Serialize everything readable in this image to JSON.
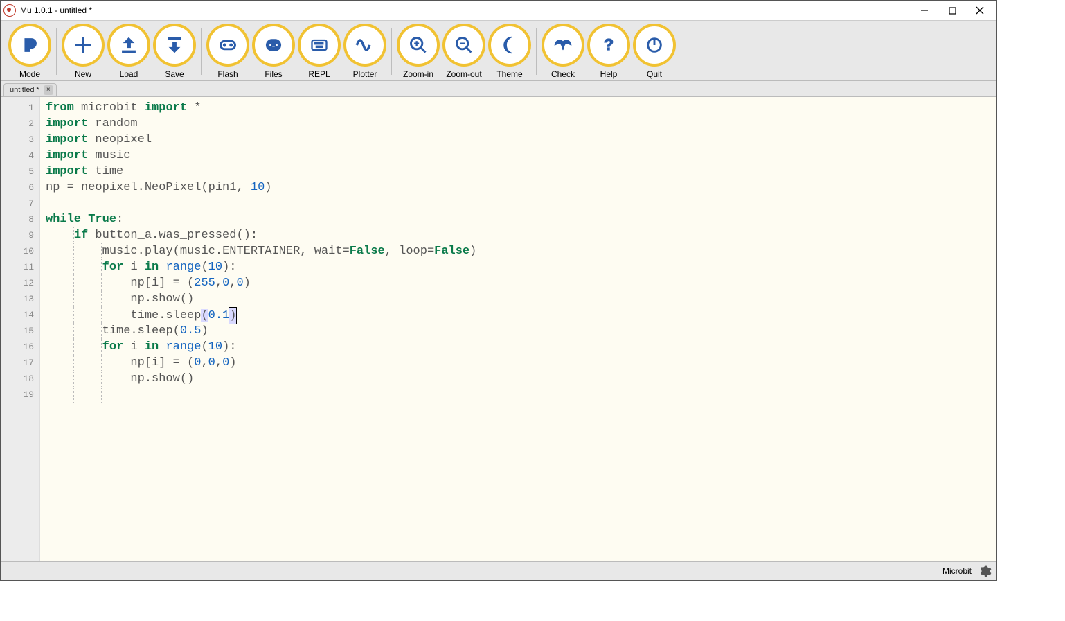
{
  "window": {
    "title": "Mu 1.0.1 - untitled *"
  },
  "toolbar": {
    "groups": [
      [
        "Mode"
      ],
      [
        "New",
        "Load",
        "Save"
      ],
      [
        "Flash",
        "Files",
        "REPL",
        "Plotter"
      ],
      [
        "Zoom-in",
        "Zoom-out",
        "Theme"
      ],
      [
        "Check",
        "Help",
        "Quit"
      ]
    ]
  },
  "tab": {
    "label": "untitled *"
  },
  "code": {
    "lines": [
      {
        "n": 1,
        "tokens": [
          [
            "kw",
            "from"
          ],
          [
            " ",
            " "
          ],
          [
            "name",
            "microbit"
          ],
          [
            " ",
            " "
          ],
          [
            "kw",
            "import"
          ],
          [
            " ",
            " "
          ],
          [
            "op",
            "*"
          ]
        ]
      },
      {
        "n": 2,
        "tokens": [
          [
            "kw",
            "import"
          ],
          [
            " ",
            " "
          ],
          [
            "name",
            "random"
          ]
        ]
      },
      {
        "n": 3,
        "tokens": [
          [
            "kw",
            "import"
          ],
          [
            " ",
            " "
          ],
          [
            "name",
            "neopixel"
          ]
        ]
      },
      {
        "n": 4,
        "tokens": [
          [
            "kw",
            "import"
          ],
          [
            " ",
            " "
          ],
          [
            "name",
            "music"
          ]
        ]
      },
      {
        "n": 5,
        "tokens": [
          [
            "kw",
            "import"
          ],
          [
            " ",
            " "
          ],
          [
            "name",
            "time"
          ]
        ]
      },
      {
        "n": 6,
        "tokens": [
          [
            "name",
            "np"
          ],
          [
            " ",
            " "
          ],
          [
            "op",
            "="
          ],
          [
            " ",
            " "
          ],
          [
            "name",
            "neopixel.NeoPixel"
          ],
          [
            "punct",
            "("
          ],
          [
            "name",
            "pin1"
          ],
          [
            "punct",
            ","
          ],
          [
            " ",
            " "
          ],
          [
            "num",
            "10"
          ],
          [
            "punct",
            ")"
          ]
        ]
      },
      {
        "n": 7,
        "tokens": []
      },
      {
        "n": 8,
        "tokens": [
          [
            "kw",
            "while"
          ],
          [
            " ",
            " "
          ],
          [
            "const",
            "True"
          ],
          [
            "punct",
            ":"
          ]
        ]
      },
      {
        "n": 9,
        "indent": 1,
        "tokens": [
          [
            "kw",
            "if"
          ],
          [
            " ",
            " "
          ],
          [
            "name",
            "button_a.was_pressed"
          ],
          [
            "punct",
            "()"
          ],
          [
            "punct",
            ":"
          ]
        ]
      },
      {
        "n": 10,
        "indent": 2,
        "tokens": [
          [
            "name",
            "music.play"
          ],
          [
            "punct",
            "("
          ],
          [
            "name",
            "music.ENTERTAINER"
          ],
          [
            "punct",
            ","
          ],
          [
            " ",
            " "
          ],
          [
            "name",
            "wait"
          ],
          [
            "op",
            "="
          ],
          [
            "const",
            "False"
          ],
          [
            "punct",
            ","
          ],
          [
            " ",
            " "
          ],
          [
            "name",
            "loop"
          ],
          [
            "op",
            "="
          ],
          [
            "const",
            "False"
          ],
          [
            "punct",
            ")"
          ]
        ]
      },
      {
        "n": 11,
        "indent": 2,
        "tokens": [
          [
            "kw",
            "for"
          ],
          [
            " ",
            " "
          ],
          [
            "name",
            "i"
          ],
          [
            " ",
            " "
          ],
          [
            "kw",
            "in"
          ],
          [
            " ",
            " "
          ],
          [
            "builtin",
            "range"
          ],
          [
            "punct",
            "("
          ],
          [
            "num",
            "10"
          ],
          [
            "punct",
            ")"
          ],
          [
            "punct",
            ":"
          ]
        ]
      },
      {
        "n": 12,
        "indent": 3,
        "tokens": [
          [
            "name",
            "np"
          ],
          [
            "punct",
            "["
          ],
          [
            "name",
            "i"
          ],
          [
            "punct",
            "]"
          ],
          [
            " ",
            " "
          ],
          [
            "op",
            "="
          ],
          [
            " ",
            " "
          ],
          [
            "punct",
            "("
          ],
          [
            "num",
            "255"
          ],
          [
            "punct",
            ","
          ],
          [
            "num",
            "0"
          ],
          [
            "punct",
            ","
          ],
          [
            "num",
            "0"
          ],
          [
            "punct",
            ")"
          ]
        ]
      },
      {
        "n": 13,
        "indent": 3,
        "tokens": [
          [
            "name",
            "np.show"
          ],
          [
            "punct",
            "()"
          ]
        ]
      },
      {
        "n": 14,
        "indent": 3,
        "highlight": true,
        "tokens": [
          [
            "name",
            "time.sleep"
          ],
          [
            "hl-paren",
            "("
          ],
          [
            "num",
            "0.1"
          ],
          [
            "hl-paren-cursor",
            ")"
          ]
        ]
      },
      {
        "n": 15,
        "indent": 2,
        "tokens": [
          [
            "name",
            "time.sleep"
          ],
          [
            "punct",
            "("
          ],
          [
            "num",
            "0.5"
          ],
          [
            "punct",
            ")"
          ]
        ]
      },
      {
        "n": 16,
        "indent": 2,
        "tokens": [
          [
            "kw",
            "for"
          ],
          [
            " ",
            " "
          ],
          [
            "name",
            "i"
          ],
          [
            " ",
            " "
          ],
          [
            "kw",
            "in"
          ],
          [
            " ",
            " "
          ],
          [
            "builtin",
            "range"
          ],
          [
            "punct",
            "("
          ],
          [
            "num",
            "10"
          ],
          [
            "punct",
            ")"
          ],
          [
            "punct",
            ":"
          ]
        ]
      },
      {
        "n": 17,
        "indent": 3,
        "tokens": [
          [
            "name",
            "np"
          ],
          [
            "punct",
            "["
          ],
          [
            "name",
            "i"
          ],
          [
            "punct",
            "]"
          ],
          [
            " ",
            " "
          ],
          [
            "op",
            "="
          ],
          [
            " ",
            " "
          ],
          [
            "punct",
            "("
          ],
          [
            "num",
            "0"
          ],
          [
            "punct",
            ","
          ],
          [
            "num",
            "0"
          ],
          [
            "punct",
            ","
          ],
          [
            "num",
            "0"
          ],
          [
            "punct",
            ")"
          ]
        ]
      },
      {
        "n": 18,
        "indent": 3,
        "tokens": [
          [
            "name",
            "np.show"
          ],
          [
            "punct",
            "()"
          ]
        ]
      },
      {
        "n": 19,
        "indent": 3,
        "tokens": []
      }
    ]
  },
  "status": {
    "mode": "Microbit"
  },
  "colors": {
    "accent": "#f1c232",
    "icon": "#2a5caa",
    "editor_bg": "#fefcf2"
  }
}
